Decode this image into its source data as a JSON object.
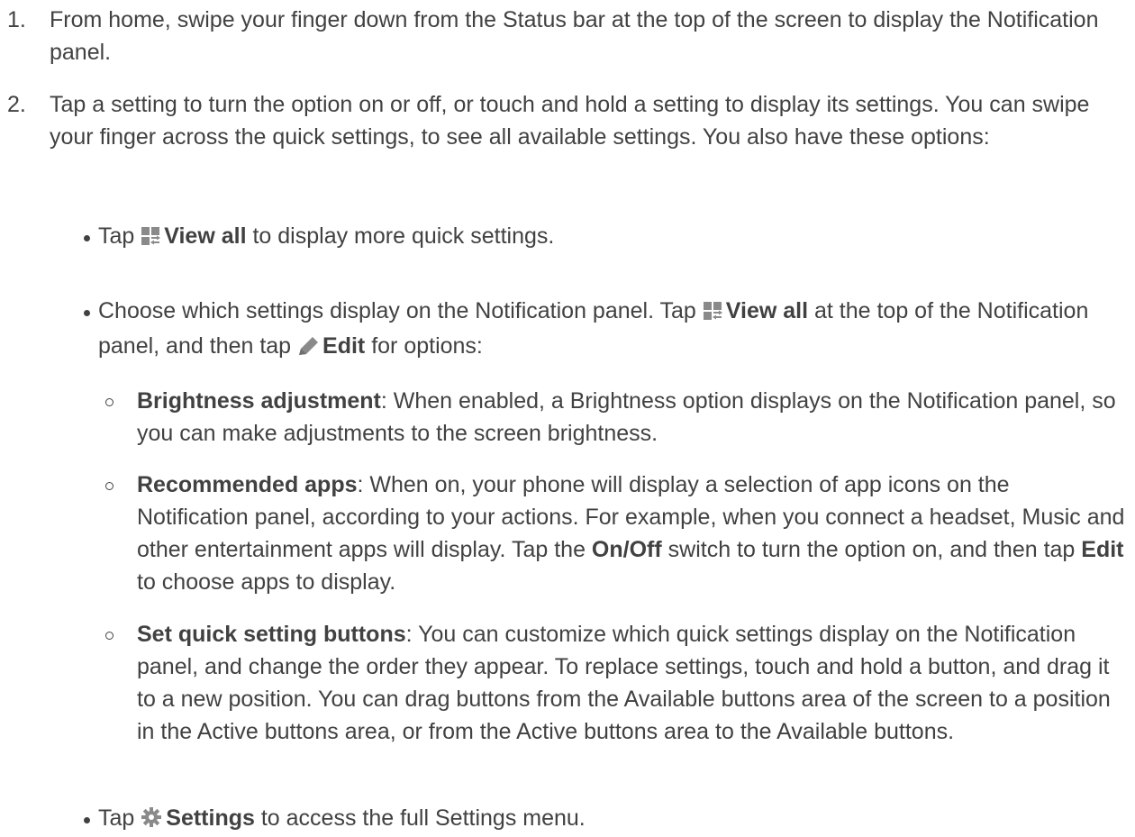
{
  "steps": [
    {
      "number": "1.",
      "text": "From home, swipe your finger down from the Status bar at the top of the screen to display the Notification panel."
    },
    {
      "number": "2.",
      "text": "Tap a setting to turn the option on or off, or touch and hold a setting to display its settings. You can swipe your finger across the quick settings, to see all available settings. You also have these options:"
    }
  ],
  "bullets": {
    "view_all": {
      "tap": "Tap ",
      "icon": "view-all-icon",
      "label": "View all",
      "rest": " to display more quick settings."
    },
    "choose": {
      "part1": "Choose which settings display on the Notification panel. Tap ",
      "view_all_icon": "view-all-icon",
      "view_all_label": "View all",
      "part2": " at the top of the Notification panel, and then tap ",
      "edit_icon": "pencil-icon",
      "edit_label": "Edit",
      "part3": " for options:"
    },
    "settings": {
      "tap": "Tap ",
      "icon": "gear-icon",
      "label": "Settings",
      "rest": " to access the full Settings menu."
    }
  },
  "sub_items": {
    "brightness": {
      "title": "Brightness adjustment",
      "text": ": When enabled, a Brightness option displays on the Notification panel, so you can make adjustments to the screen brightness."
    },
    "recommended": {
      "title": "Recommended apps",
      "text1": ": When on, your phone will display a selection of app icons on the Notification panel, according to your actions. For example, when you connect a headset, Music and other entertainment apps will display. Tap the ",
      "onoff": "On/Off",
      "text2": " switch to turn the option on, and then tap ",
      "edit": "Edit",
      "text3": " to choose apps to display."
    },
    "quick_buttons": {
      "title": "Set quick setting buttons",
      "text": ": You can customize which quick settings display on the Notification panel, and change the order they appear. To replace settings, touch and hold a button, and drag it to a new position. You can drag buttons from the Available buttons area of the screen to a position in the Active buttons area, or from the Active buttons area to the Available buttons."
    }
  },
  "colors": {
    "text": "#414141",
    "icon": "#8a8a8a"
  }
}
